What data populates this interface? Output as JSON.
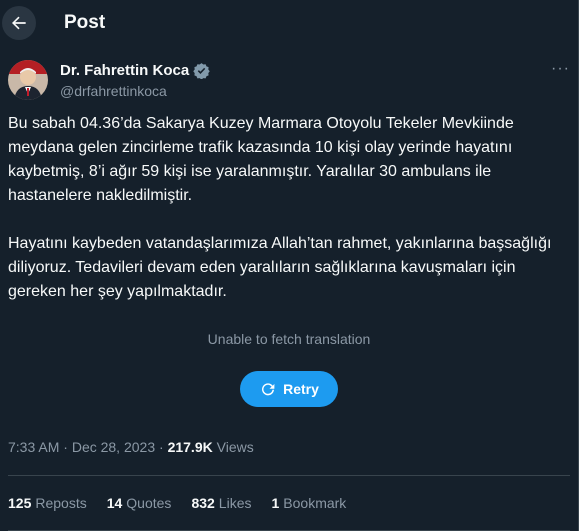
{
  "header": {
    "title": "Post",
    "back_icon": "arrow-left-icon"
  },
  "author": {
    "name": "Dr. Fahrettin Koca",
    "handle": "@drfahrettinkoca",
    "verified_icon": "verified-badge-icon",
    "more_label": "···"
  },
  "post": {
    "paragraph1": "Bu sabah 04.36’da Sakarya Kuzey Marmara Otoyolu Tekeler Mevkiinde meydana gelen zincirleme trafik kazasında 10 kişi olay yerinde hayatını kaybetmiş, 8’i ağır 59 kişi ise yaralanmıştır. Yaralılar 30 ambulans ile hastanelere nakledilmiştir.",
    "paragraph2": "Hayatını kaybeden vatandaşlarımıza Allah’tan rahmet, yakınlarına başsağlığı diliyoruz. Tedavileri devam eden yaralıların sağlıklarına kavuşmaları için gereken her şey yapılmaktadır."
  },
  "translation": {
    "note": "Unable to fetch translation",
    "retry_label": "Retry",
    "retry_icon": "refresh-icon"
  },
  "meta": {
    "time": "7:33 AM",
    "separator": " · ",
    "date": "Dec 28, 2023",
    "views_count": "217.9K",
    "views_label": "Views"
  },
  "stats": {
    "reposts_count": "125",
    "reposts_label": "Reposts",
    "quotes_count": "14",
    "quotes_label": "Quotes",
    "likes_count": "832",
    "likes_label": "Likes",
    "bookmarks_count": "1",
    "bookmarks_label": "Bookmark"
  },
  "colors": {
    "background": "#15202b",
    "accent": "#1d9bf0",
    "muted": "#8b98a5",
    "text": "#f7f9f9"
  }
}
